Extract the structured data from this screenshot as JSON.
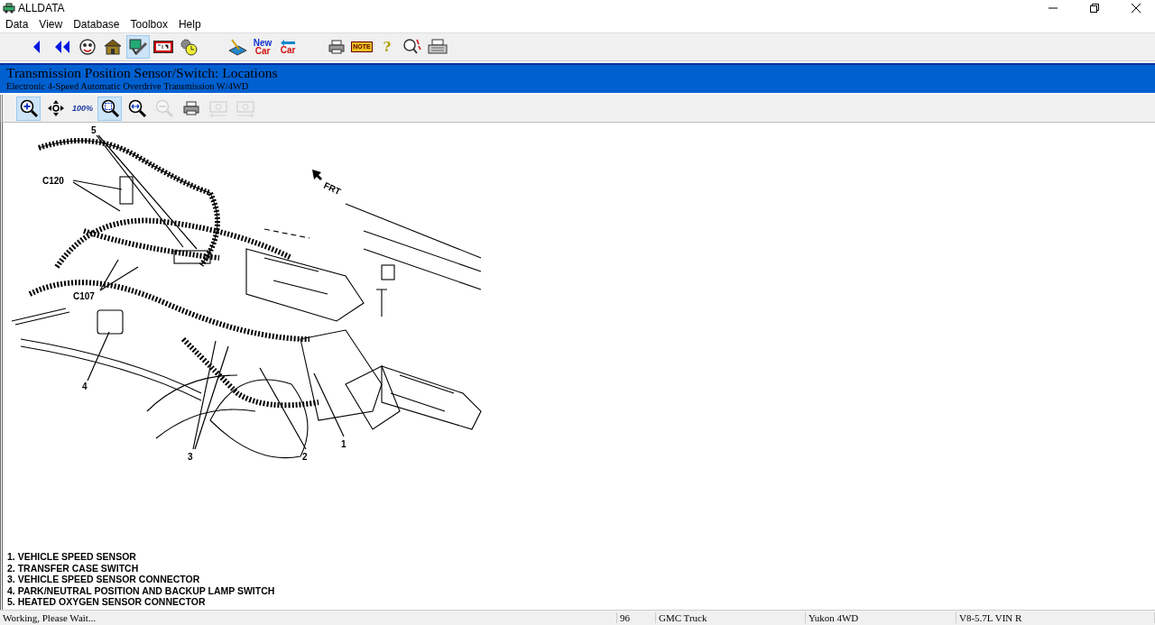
{
  "window": {
    "title": "ALLDATA"
  },
  "menu": [
    "Data",
    "View",
    "Database",
    "Toolbox",
    "Help"
  ],
  "toolbar_groups": [
    [
      {
        "kind": "back",
        "selected": false
      },
      {
        "kind": "back-all",
        "selected": false
      },
      {
        "kind": "face",
        "selected": false
      },
      {
        "kind": "house",
        "selected": false
      },
      {
        "kind": "diagnostic",
        "selected": true
      },
      {
        "kind": "counter",
        "selected": false
      },
      {
        "kind": "gear-clock",
        "selected": false
      }
    ],
    [
      {
        "kind": "pen-pad",
        "selected": false
      },
      {
        "kind": "new-car",
        "selected": false,
        "lines": [
          "New",
          "Car"
        ]
      },
      {
        "kind": "car-arrow",
        "selected": false,
        "lines": [
          "Car"
        ]
      }
    ],
    [
      {
        "kind": "printer",
        "selected": false
      },
      {
        "kind": "note",
        "selected": false,
        "lines": [
          "NOTE"
        ]
      },
      {
        "kind": "help",
        "selected": false,
        "lines": [
          "?"
        ]
      },
      {
        "kind": "search",
        "selected": false
      },
      {
        "kind": "fax",
        "selected": false
      }
    ]
  ],
  "header": {
    "title": "Transmission Position Sensor/Switch:  Locations",
    "subtitle": "Electronic 4-Speed Automatic Overdrive Transmission W/4WD"
  },
  "zoom_toolbar": [
    {
      "kind": "zoom-in",
      "selected": true,
      "disabled": false
    },
    {
      "kind": "pan",
      "selected": false,
      "disabled": false
    },
    {
      "kind": "actual-size",
      "selected": false,
      "disabled": false,
      "lines": [
        "100%"
      ]
    },
    {
      "kind": "fit",
      "selected": true,
      "disabled": false
    },
    {
      "kind": "fit-width",
      "selected": false,
      "disabled": false
    },
    {
      "kind": "zoom-out",
      "selected": false,
      "disabled": true
    },
    {
      "kind": "printer",
      "selected": false,
      "disabled": false
    },
    {
      "kind": "camera-prev",
      "selected": false,
      "disabled": true
    },
    {
      "kind": "camera-next",
      "selected": false,
      "disabled": true
    }
  ],
  "diagram": {
    "callouts": [
      "5",
      "C120",
      "FRT",
      "C107",
      "4",
      "3",
      "2",
      "1"
    ]
  },
  "legend": [
    "1. VEHICLE SPEED SENSOR",
    "2. TRANSFER CASE SWITCH",
    "3. VEHICLE SPEED SENSOR CONNECTOR",
    "4. PARK/NEUTRAL POSITION AND BACKUP LAMP SWITCH",
    "5. HEATED OXYGEN SENSOR CONNECTOR"
  ],
  "status_bar": [
    "Working,  Please Wait...",
    "96",
    "GMC Truck",
    "Yukon 4WD",
    "V8-5.7L VIN R"
  ]
}
